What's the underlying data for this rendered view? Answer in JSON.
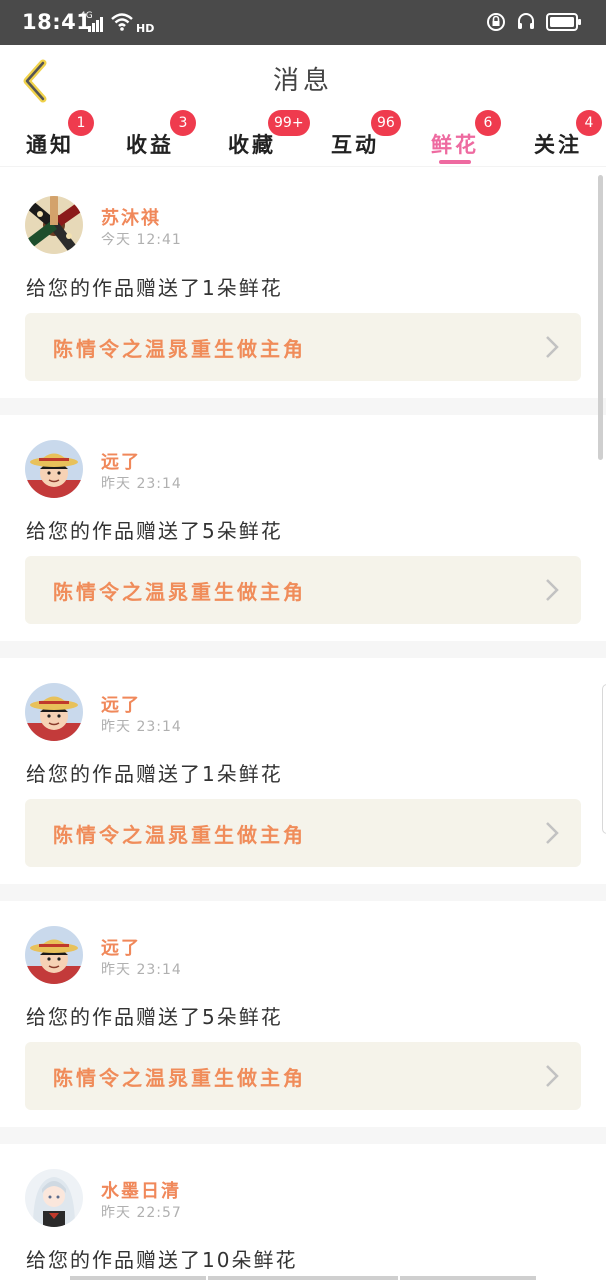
{
  "status_bar": {
    "time": "18:41",
    "network": "4G",
    "hd": "HD"
  },
  "header": {
    "title": "消息"
  },
  "tabs": [
    {
      "label": "通知",
      "badge": "1"
    },
    {
      "label": "收益",
      "badge": "3"
    },
    {
      "label": "收藏",
      "badge": "99+"
    },
    {
      "label": "互动",
      "badge": "96"
    },
    {
      "label": "鲜花",
      "badge": "6",
      "active": true
    },
    {
      "label": "关注",
      "badge": "4"
    }
  ],
  "colors": {
    "accent_pink": "#ee6aa0",
    "username_orange": "#f0885a",
    "badge_red": "#ef3b4e",
    "work_bg": "#f5f3ea"
  },
  "messages": [
    {
      "user": "苏沐祺",
      "time": "今天 12:41",
      "text": "给您的作品赠送了1朵鲜花",
      "work": "陈情令之温晁重生做主角",
      "avatar": "hands-avatar"
    },
    {
      "user": "远了",
      "time": "昨天 23:14",
      "text": "给您的作品赠送了5朵鲜花",
      "work": "陈情令之温晁重生做主角",
      "avatar": "luffy-avatar"
    },
    {
      "user": "远了",
      "time": "昨天 23:14",
      "text": "给您的作品赠送了1朵鲜花",
      "work": "陈情令之温晁重生做主角",
      "avatar": "luffy-avatar"
    },
    {
      "user": "远了",
      "time": "昨天 23:14",
      "text": "给您的作品赠送了5朵鲜花",
      "work": "陈情令之温晁重生做主角",
      "avatar": "luffy-avatar"
    },
    {
      "user": "水墨日清",
      "time": "昨天 22:57",
      "text": "给您的作品赠送了10朵鲜花",
      "work": "",
      "avatar": "anime-girl-avatar"
    }
  ]
}
